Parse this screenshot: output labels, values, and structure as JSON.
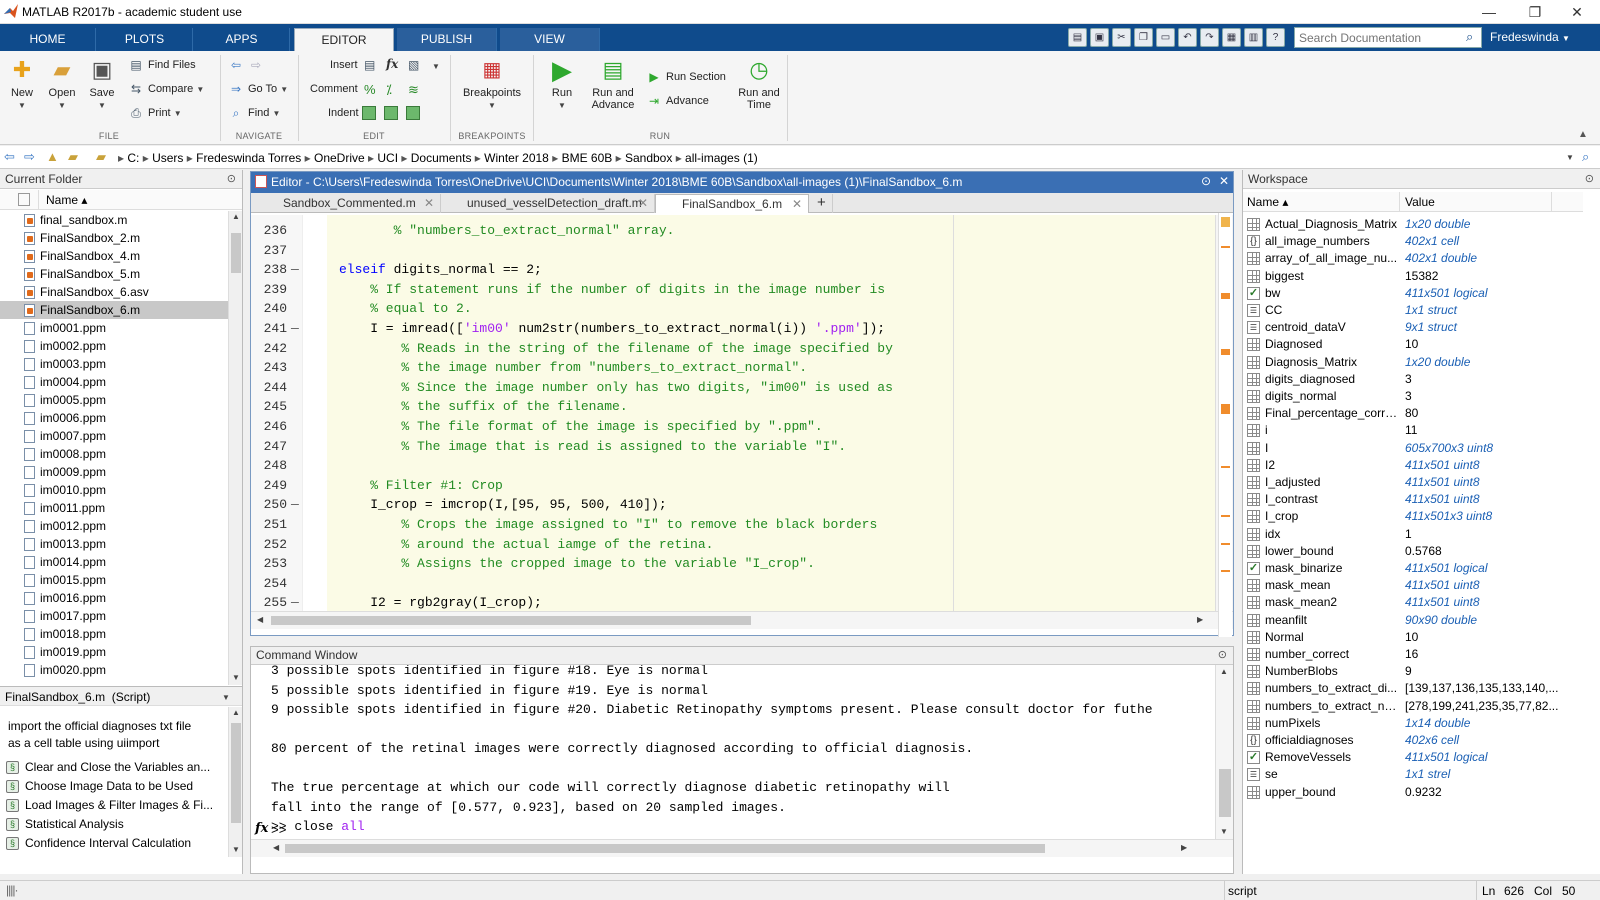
{
  "window": {
    "title": "MATLAB R2017b - academic student use",
    "minimize": "—",
    "restore": "❐",
    "close": "✕"
  },
  "tabs": [
    {
      "label": "HOME"
    },
    {
      "label": "PLOTS"
    },
    {
      "label": "APPS"
    },
    {
      "label": "EDITOR"
    },
    {
      "label": "PUBLISH"
    },
    {
      "label": "VIEW"
    }
  ],
  "search": {
    "placeholder": "Search Documentation"
  },
  "user": "Fredeswinda",
  "ribbon": {
    "file": {
      "new": "New",
      "open": "Open",
      "save": "Save",
      "find_files": "Find Files",
      "compare": "Compare",
      "print": "Print",
      "group": "FILE"
    },
    "navigate": {
      "go_to": "Go To",
      "find": "Find",
      "group": "NAVIGATE"
    },
    "edit": {
      "insert": "Insert",
      "comment": "Comment",
      "indent": "Indent",
      "group": "EDIT"
    },
    "breakpoints": {
      "label": "Breakpoints",
      "group": "BREAKPOINTS"
    },
    "run": {
      "run": "Run",
      "run_advance_1": "Run and",
      "run_advance_2": "Advance",
      "run_section": "Run Section",
      "advance": "Advance",
      "run_time_1": "Run and",
      "run_time_2": "Time",
      "group": "RUN"
    }
  },
  "address": {
    "crumbs": [
      "C:",
      "Users",
      "Fredeswinda Torres",
      "OneDrive",
      "UCI",
      "Documents",
      "Winter 2018",
      "BME 60B",
      "Sandbox",
      "all-images (1)"
    ]
  },
  "current_folder": {
    "title": "Current Folder",
    "col_name": "Name ▴",
    "files": [
      "final_sandbox.m",
      "FinalSandbox_2.m",
      "FinalSandbox_4.m",
      "FinalSandbox_5.m",
      "FinalSandbox_6.asv",
      "FinalSandbox_6.m",
      "im0001.ppm",
      "im0002.ppm",
      "im0003.ppm",
      "im0004.ppm",
      "im0005.ppm",
      "im0006.ppm",
      "im0007.ppm",
      "im0008.ppm",
      "im0009.ppm",
      "im0010.ppm",
      "im0011.ppm",
      "im0012.ppm",
      "im0013.ppm",
      "im0014.ppm",
      "im0015.ppm",
      "im0016.ppm",
      "im0017.ppm",
      "im0018.ppm",
      "im0019.ppm",
      "im0020.ppm"
    ],
    "selected": "FinalSandbox_6.m"
  },
  "details": {
    "title": "FinalSandbox_6.m  (Script)",
    "description_1": "import the official diagnoses txt file",
    "description_2": "as a cell table using uiimport",
    "sections": [
      "Clear and Close the Variables an...",
      "Choose Image Data to be Used",
      "Load Images & Filter Images & Fi...",
      "Statistical Analysis",
      "Confidence Interval Calculation"
    ]
  },
  "editor": {
    "title": "Editor - C:\\Users\\Fredeswinda Torres\\OneDrive\\UCI\\Documents\\Winter 2018\\BME 60B\\Sandbox\\all-images (1)\\FinalSandbox_6.m",
    "tabs": [
      "Sandbox_Commented.m",
      "unused_vesselDetection_draft.m",
      "FinalSandbox_6.m"
    ],
    "add_tab": "+",
    "lines": [
      {
        "n": "236",
        "fold": "",
        "segs": [
          {
            "t": "       % \"numbers_to_extract_normal\" array.",
            "c": "cm"
          }
        ]
      },
      {
        "n": "237",
        "fold": "",
        "segs": []
      },
      {
        "n": "238",
        "fold": "—",
        "segs": [
          {
            "t": "elseif",
            "c": "kw"
          },
          {
            "t": " digits_normal == 2;",
            "c": ""
          }
        ]
      },
      {
        "n": "239",
        "fold": "",
        "segs": [
          {
            "t": "    % If statement runs if the number of digits in the image number is",
            "c": "cm"
          }
        ]
      },
      {
        "n": "240",
        "fold": "",
        "segs": [
          {
            "t": "    % equal to 2.",
            "c": "cm"
          }
        ]
      },
      {
        "n": "241",
        "fold": "—",
        "segs": [
          {
            "t": "    I = imread([",
            "c": ""
          },
          {
            "t": "'im00'",
            "c": "st"
          },
          {
            "t": " num2str(numbers_to_extract_normal(i)) ",
            "c": ""
          },
          {
            "t": "'.ppm'",
            "c": "st"
          },
          {
            "t": "]);",
            "c": ""
          }
        ]
      },
      {
        "n": "242",
        "fold": "",
        "segs": [
          {
            "t": "        % Reads in the string of the filename of the image specified by",
            "c": "cm"
          }
        ]
      },
      {
        "n": "243",
        "fold": "",
        "segs": [
          {
            "t": "        % the image number from \"numbers_to_extract_normal\".",
            "c": "cm"
          }
        ]
      },
      {
        "n": "244",
        "fold": "",
        "segs": [
          {
            "t": "        % Since the image number only has two digits, \"im00\" is used as",
            "c": "cm"
          }
        ]
      },
      {
        "n": "245",
        "fold": "",
        "segs": [
          {
            "t": "        % the suffix of the filename.",
            "c": "cm"
          }
        ]
      },
      {
        "n": "246",
        "fold": "",
        "segs": [
          {
            "t": "        % The file format of the image is specified by \".ppm\".",
            "c": "cm"
          }
        ]
      },
      {
        "n": "247",
        "fold": "",
        "segs": [
          {
            "t": "        % The image that is read is assigned to the variable \"I\".",
            "c": "cm"
          }
        ]
      },
      {
        "n": "248",
        "fold": "",
        "segs": []
      },
      {
        "n": "249",
        "fold": "",
        "segs": [
          {
            "t": "    % Filter #1: Crop",
            "c": "cm"
          }
        ]
      },
      {
        "n": "250",
        "fold": "—",
        "segs": [
          {
            "t": "    I_crop = imcrop(I,[95, 95, 500, 410]);",
            "c": ""
          }
        ]
      },
      {
        "n": "251",
        "fold": "",
        "segs": [
          {
            "t": "        % Crops the image assigned to \"I\" to remove the black borders",
            "c": "cm"
          }
        ]
      },
      {
        "n": "252",
        "fold": "",
        "segs": [
          {
            "t": "        % around the actual iamge of the retina.",
            "c": "cm"
          }
        ]
      },
      {
        "n": "253",
        "fold": "",
        "segs": [
          {
            "t": "        % Assigns the cropped image to the variable \"I_crop\".",
            "c": "cm"
          }
        ]
      },
      {
        "n": "254",
        "fold": "",
        "segs": []
      },
      {
        "n": "255",
        "fold": "—",
        "segs": [
          {
            "t": "    I2 = rgb2gray(I_crop);",
            "c": ""
          }
        ]
      }
    ]
  },
  "command_window": {
    "title": "Command Window",
    "lines": [
      {
        "t": "3 possible spots identified in figure #18. Eye is normal",
        "c": ""
      },
      {
        "t": "5 possible spots identified in figure #19. Eye is normal",
        "c": ""
      },
      {
        "t": "9 possible spots identified in figure #20. Diabetic Retinopathy symptoms present. Please consult doctor for futhe",
        "c": ""
      },
      {
        "t": "",
        "c": ""
      },
      {
        "t": "80 percent of the retinal images were correctly diagnosed according to official diagnosis.",
        "c": ""
      },
      {
        "t": "",
        "c": ""
      },
      {
        "t": "The true percentage at which our code will correctly diagnose diabetic retinopathy will",
        "c": ""
      },
      {
        "t": "fall into the range of [0.577, 0.923], based on 20 sampled images.",
        "c": ""
      }
    ],
    "last_cmd": ">> close ",
    "last_cmd_kw": "all",
    "prompt_fx": "fx",
    "prompt": ">>"
  },
  "workspace": {
    "title": "Workspace",
    "col_name": "Name ▴",
    "col_value": "Value",
    "vars": [
      {
        "name": "Actual_Diagnosis_Matrix",
        "value": "1x20 double",
        "link": true,
        "icon": "grid"
      },
      {
        "name": "all_image_numbers",
        "value": "402x1 cell",
        "link": true,
        "icon": "cell"
      },
      {
        "name": "array_of_all_image_nu...",
        "value": "402x1 double",
        "link": true,
        "icon": "grid"
      },
      {
        "name": "biggest",
        "value": "15382",
        "link": false,
        "icon": "grid"
      },
      {
        "name": "bw",
        "value": "411x501 logical",
        "link": true,
        "icon": "check"
      },
      {
        "name": "CC",
        "value": "1x1 struct",
        "link": true,
        "icon": "struct"
      },
      {
        "name": "centroid_dataV",
        "value": "9x1 struct",
        "link": true,
        "icon": "struct"
      },
      {
        "name": "Diagnosed",
        "value": "10",
        "link": false,
        "icon": "grid"
      },
      {
        "name": "Diagnosis_Matrix",
        "value": "1x20 double",
        "link": true,
        "icon": "grid"
      },
      {
        "name": "digits_diagnosed",
        "value": "3",
        "link": false,
        "icon": "grid"
      },
      {
        "name": "digits_normal",
        "value": "3",
        "link": false,
        "icon": "grid"
      },
      {
        "name": "Final_percentage_corre...",
        "value": "80",
        "link": false,
        "icon": "grid"
      },
      {
        "name": "i",
        "value": "11",
        "link": false,
        "icon": "grid"
      },
      {
        "name": "I",
        "value": "605x700x3 uint8",
        "link": true,
        "icon": "grid"
      },
      {
        "name": "I2",
        "value": "411x501 uint8",
        "link": true,
        "icon": "grid"
      },
      {
        "name": "I_adjusted",
        "value": "411x501 uint8",
        "link": true,
        "icon": "grid"
      },
      {
        "name": "I_contrast",
        "value": "411x501 uint8",
        "link": true,
        "icon": "grid"
      },
      {
        "name": "I_crop",
        "value": "411x501x3 uint8",
        "link": true,
        "icon": "grid"
      },
      {
        "name": "idx",
        "value": "1",
        "link": false,
        "icon": "grid"
      },
      {
        "name": "lower_bound",
        "value": "0.5768",
        "link": false,
        "icon": "grid"
      },
      {
        "name": "mask_binarize",
        "value": "411x501 logical",
        "link": true,
        "icon": "check"
      },
      {
        "name": "mask_mean",
        "value": "411x501 uint8",
        "link": true,
        "icon": "grid"
      },
      {
        "name": "mask_mean2",
        "value": "411x501 uint8",
        "link": true,
        "icon": "grid"
      },
      {
        "name": "meanfilt",
        "value": "90x90 double",
        "link": true,
        "icon": "grid"
      },
      {
        "name": "Normal",
        "value": "10",
        "link": false,
        "icon": "grid"
      },
      {
        "name": "number_correct",
        "value": "16",
        "link": false,
        "icon": "grid"
      },
      {
        "name": "NumberBlobs",
        "value": "9",
        "link": false,
        "icon": "grid"
      },
      {
        "name": "numbers_to_extract_di...",
        "value": "[139,137,136,135,133,140,...",
        "link": false,
        "icon": "grid"
      },
      {
        "name": "numbers_to_extract_no...",
        "value": "[278,199,241,235,35,77,82...",
        "link": false,
        "icon": "grid"
      },
      {
        "name": "numPixels",
        "value": "1x14 double",
        "link": true,
        "icon": "grid"
      },
      {
        "name": "officialdiagnoses",
        "value": "402x6 cell",
        "link": true,
        "icon": "cell"
      },
      {
        "name": "RemoveVessels",
        "value": "411x501 logical",
        "link": true,
        "icon": "check"
      },
      {
        "name": "se",
        "value": "1x1 strel",
        "link": true,
        "icon": "struct"
      },
      {
        "name": "upper_bound",
        "value": "0.9232",
        "link": false,
        "icon": "grid"
      }
    ]
  },
  "status": {
    "mode": "script",
    "ln_label": "Ln",
    "ln": "626",
    "col_label": "Col",
    "col": "50"
  },
  "colors": {
    "accent": "#0f4b8c",
    "editor_title": "#3a6fb4",
    "code_bg": "#fbfbe6",
    "keyword": "#0000ff",
    "comment": "#228b22",
    "string": "#a020f0"
  }
}
